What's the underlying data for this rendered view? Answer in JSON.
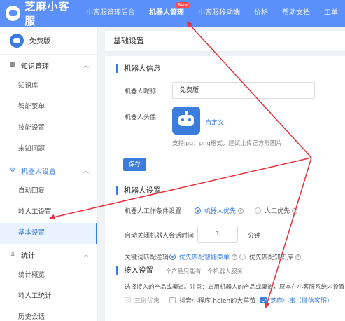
{
  "app": {
    "logo_text": "芝麻小客服"
  },
  "topnav": {
    "items": [
      {
        "label": "小客服管理后台",
        "active": false
      },
      {
        "label": "机器人管理",
        "active": true,
        "badge": "Beta"
      },
      {
        "label": "小客服移动端",
        "active": false
      },
      {
        "label": "价格",
        "active": false
      },
      {
        "label": "帮助文档",
        "active": false
      },
      {
        "label": "工单",
        "active": false
      }
    ]
  },
  "sidebar": {
    "plan_label": "免费版",
    "groups": [
      {
        "label": "知识管理",
        "icon": "grid-icon",
        "items": [
          "知识库",
          "智能菜单",
          "技能设置",
          "未知问题"
        ]
      },
      {
        "label": "机器人设置",
        "icon": "gear-icon",
        "items": [
          "自动回复",
          "转人工设置",
          "基本设置"
        ],
        "active_item": "基本设置"
      },
      {
        "label": "统计",
        "icon": "chart-icon",
        "items": [
          "统计概览",
          "转人工统计",
          "历史会话"
        ]
      }
    ]
  },
  "main": {
    "page_title": "基础设置",
    "robot_info": {
      "section_title": "机器人信息",
      "nickname_label": "机器人昵称",
      "nickname_value": "免费版",
      "avatar_label": "机器人头像",
      "custom_link": "自定义",
      "avatar_hint": "支持jpg、png格式，建议上传正方形图片",
      "save_button": "保存"
    },
    "robot_settings": {
      "section_title": "机器人设置",
      "work_condition_label": "机器人工作条件设置",
      "work_condition_options": [
        {
          "label": "机器人优先",
          "checked": true
        },
        {
          "label": "人工优先",
          "checked": false
        }
      ],
      "auto_close_label": "自动关闭机器人会话时间",
      "auto_close_value": "1",
      "auto_close_unit": "分钟",
      "keyword_label": "关键词匹配逻辑",
      "keyword_options": [
        {
          "label": "优先匹配智能菜单",
          "checked": true
        },
        {
          "label": "优先匹配知识库",
          "checked": false
        }
      ]
    },
    "access": {
      "section_title": "接入设置",
      "section_hint": "一个产品只能有一个机器人服务",
      "note": "选择接入的产品或渠道。注意：启用机器人的产品或渠道，原本在小客服系统内设置的",
      "channels": [
        {
          "label": "三拼优惠",
          "checked": false,
          "disabled": true
        },
        {
          "label": "抖音小程序-helen的大草莓",
          "checked": false,
          "disabled": false
        },
        {
          "label": "芝麻小事（微信客服）",
          "checked": true,
          "disabled": false
        }
      ]
    }
  },
  "colors": {
    "nav_bg": "#5b8ff9",
    "accent": "#3b7ddd",
    "annotation_arrow": "#e8303c"
  }
}
